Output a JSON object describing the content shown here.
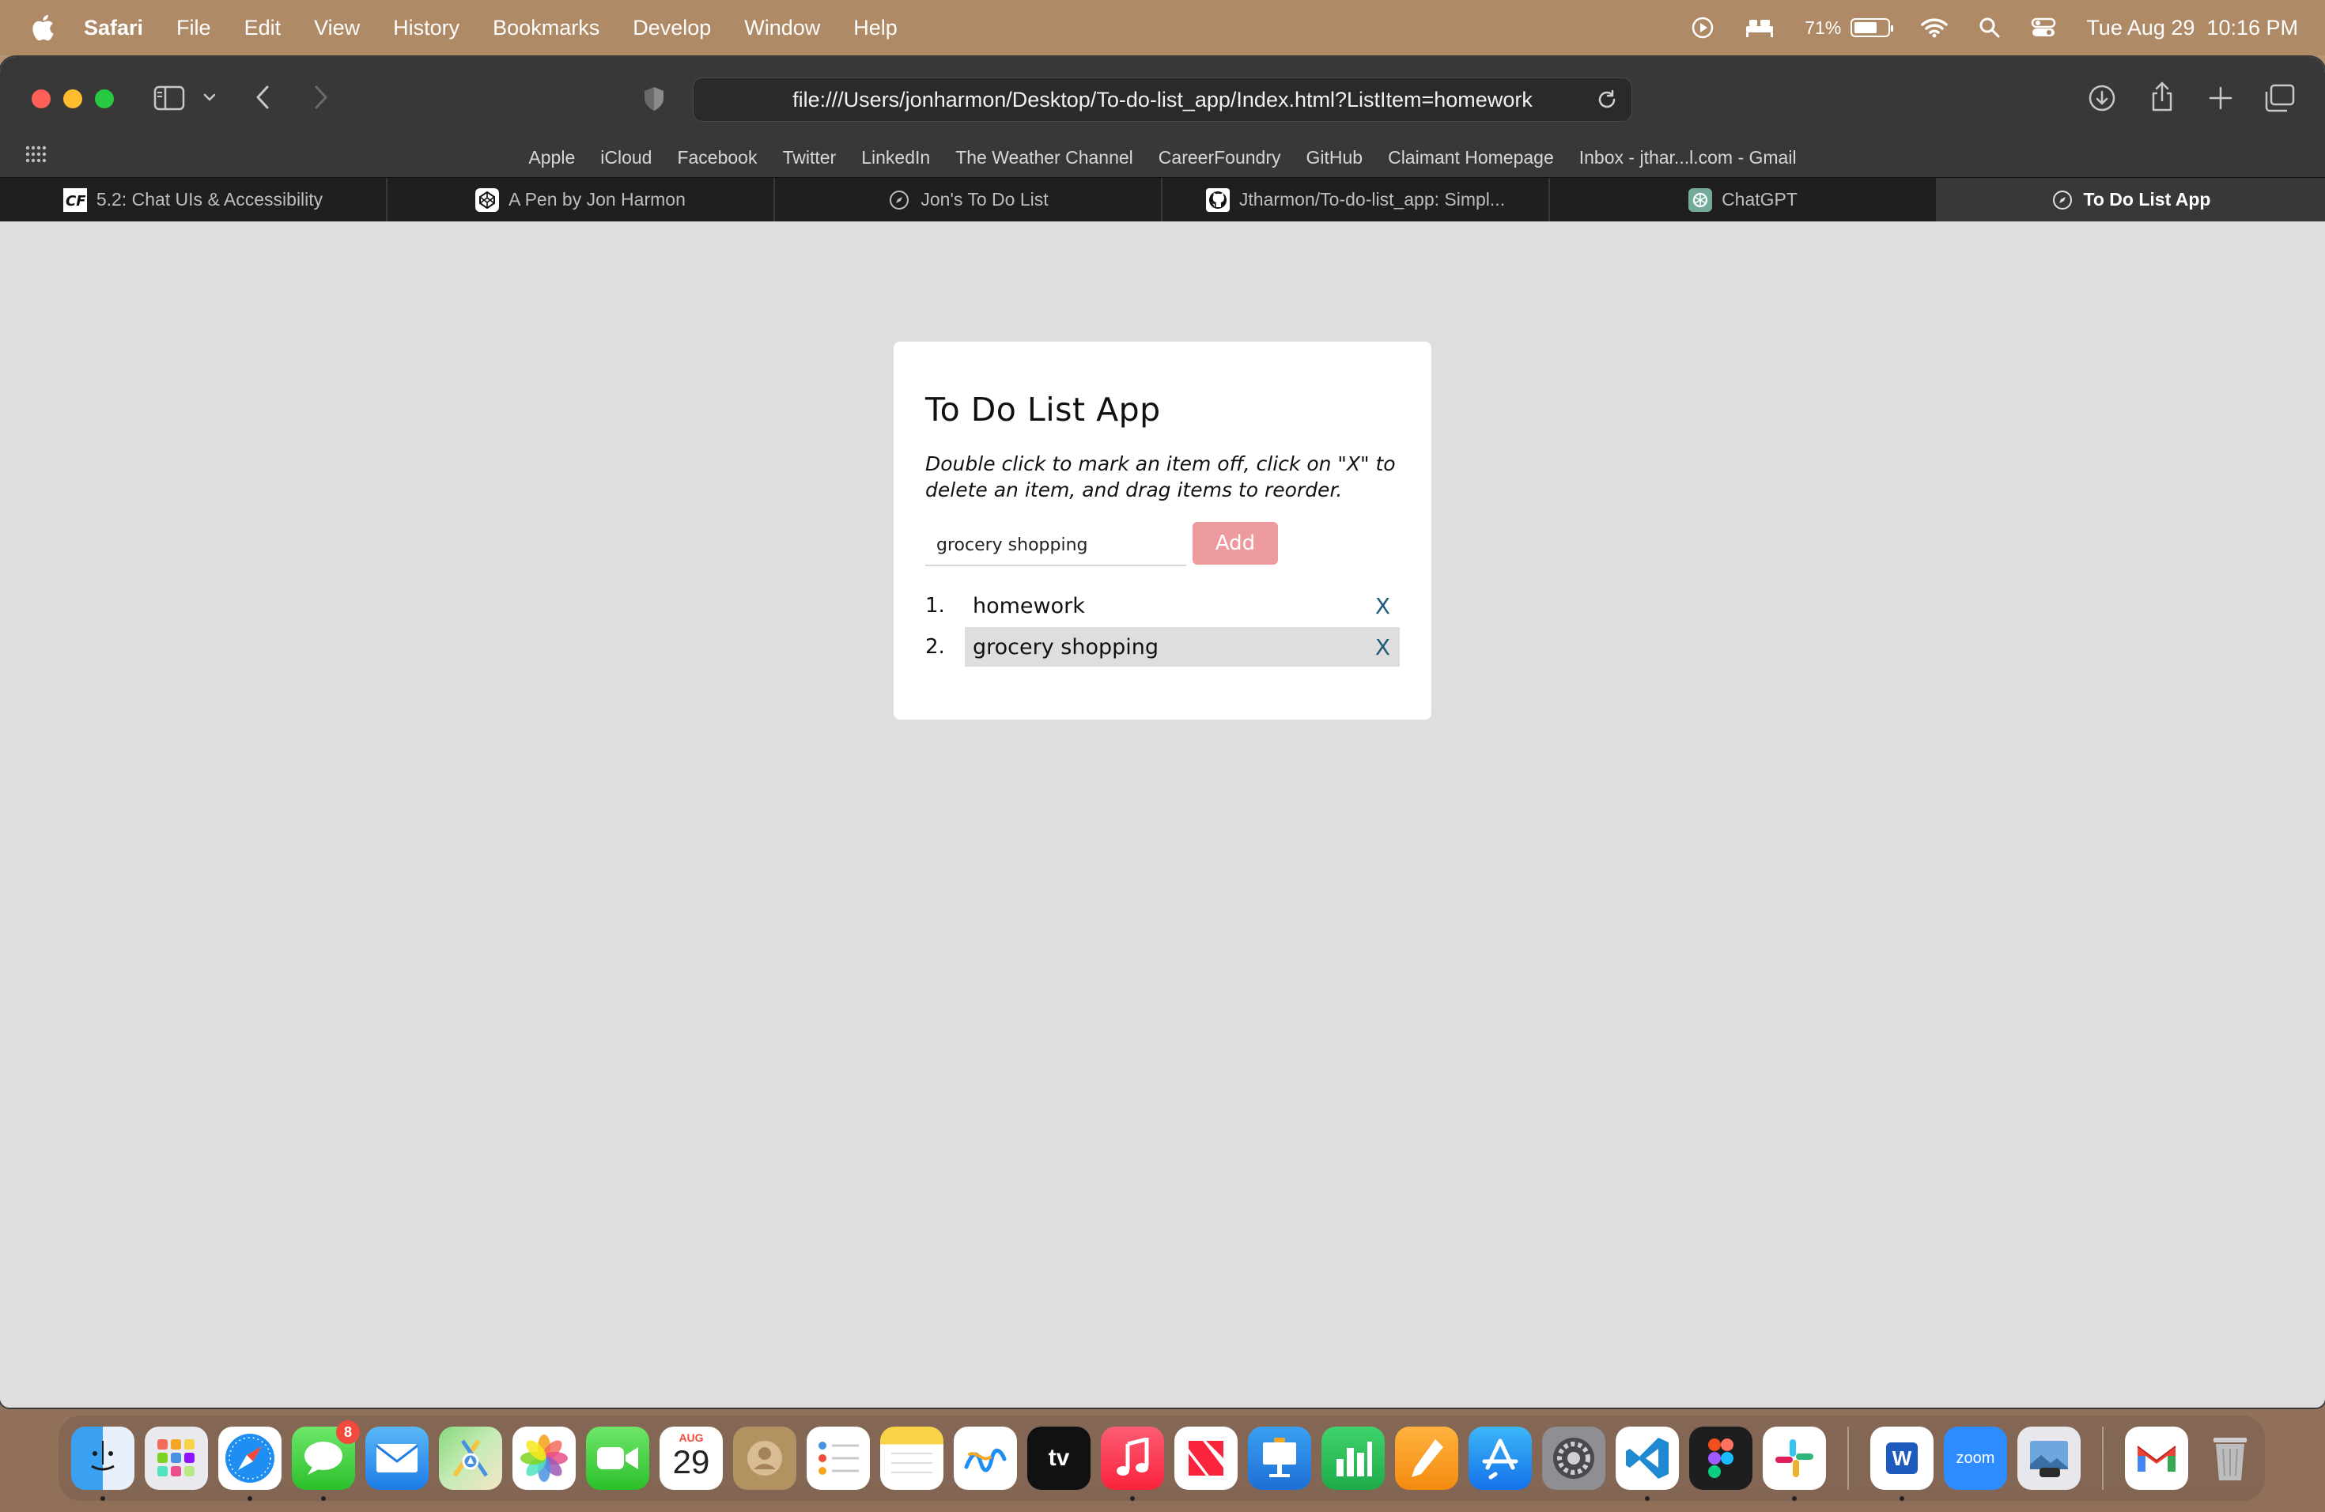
{
  "menubar": {
    "app_name": "Safari",
    "items": [
      "File",
      "Edit",
      "View",
      "History",
      "Bookmarks",
      "Develop",
      "Window",
      "Help"
    ],
    "battery_percent": "71%",
    "datetime": "Tue Aug 29  10:16 PM"
  },
  "browser": {
    "url": "file:///Users/jonharmon/Desktop/To-do-list_app/Index.html?ListItem=homework",
    "favorites": [
      "Apple",
      "iCloud",
      "Facebook",
      "Twitter",
      "LinkedIn",
      "The Weather Channel",
      "CareerFoundry",
      "GitHub",
      "Claimant Homepage",
      "Inbox - jthar...l.com - Gmail"
    ],
    "tabs": [
      {
        "label": "5.2: Chat UIs & Accessibility",
        "icon": "careerfoundry-icon"
      },
      {
        "label": "A Pen by Jon Harmon",
        "icon": "codepen-icon"
      },
      {
        "label": "Jon's To Do List",
        "icon": "compass-icon"
      },
      {
        "label": "Jtharmon/To-do-list_app: Simpl...",
        "icon": "github-icon"
      },
      {
        "label": "ChatGPT",
        "icon": "chatgpt-icon"
      },
      {
        "label": "To Do List App",
        "icon": "compass-icon",
        "active": true
      }
    ]
  },
  "app": {
    "title": "To Do List App",
    "instructions": "Double click to mark an item off, click on \"X\" to delete an item, and drag items to reorder.",
    "input_value": "grocery shopping",
    "add_label": "Add",
    "items": [
      {
        "num": "1.",
        "text": "homework",
        "delete": "X"
      },
      {
        "num": "2.",
        "text": "grocery shopping",
        "delete": "X"
      }
    ]
  },
  "dock": {
    "apps": [
      "Finder",
      "Launchpad",
      "Safari",
      "Messages",
      "Mail",
      "Maps",
      "Photos",
      "FaceTime",
      "Calendar",
      "Contacts",
      "Reminders",
      "Notes",
      "Freeform",
      "TV",
      "Music",
      "News",
      "Keynote",
      "Numbers",
      "Pages",
      "App Store",
      "System Settings",
      "Visual Studio Code",
      "Figma",
      "Slack",
      "Microsoft Word",
      "Zoom",
      "Preview",
      "Gmail",
      "Trash"
    ],
    "messages_badge": "8",
    "calendar_month": "AUG",
    "calendar_day": "29",
    "tv_label": "tv",
    "word_label": "W",
    "zoom_label": "zoom"
  },
  "colors": {
    "add_button": "#ed9a9f",
    "delete_x": "#1f5a7a",
    "page_bg": "#dedede"
  }
}
